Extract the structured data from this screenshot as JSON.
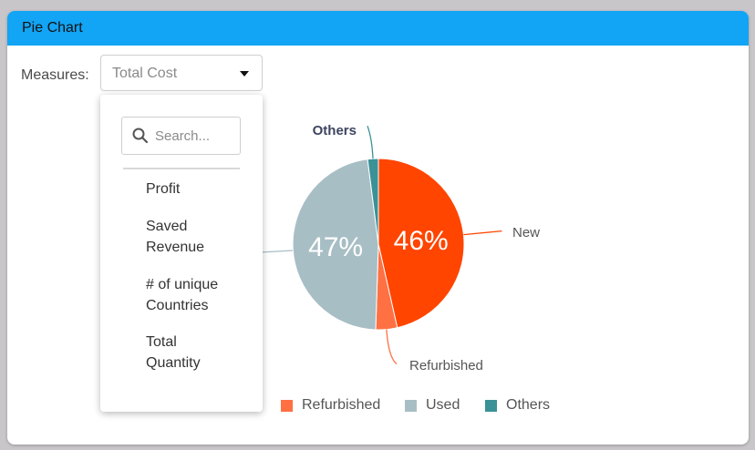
{
  "panel": {
    "title": "Pie Chart"
  },
  "measures": {
    "label": "Measures:",
    "selected": "Total Cost",
    "search_placeholder": "Search...",
    "options": [
      {
        "line1": "Profit",
        "line2": ""
      },
      {
        "line1": "Saved",
        "line2": "Revenue"
      },
      {
        "line1": "# of unique",
        "line2": "Countries"
      },
      {
        "line1": "Total",
        "line2": "Quantity"
      }
    ]
  },
  "colors": {
    "header": "#12a4f5",
    "new": "#ff4500",
    "refurbished": "#ff7043",
    "used": "#a8bec5",
    "others": "#3a9196"
  },
  "chart_data": {
    "type": "pie",
    "slices": [
      {
        "name": "New",
        "value": 46,
        "label": "46%",
        "color": "#ff4500"
      },
      {
        "name": "Refurbished",
        "value": 4,
        "label": "",
        "color": "#ff7043"
      },
      {
        "name": "Used",
        "value": 47,
        "label": "47%",
        "color": "#a8bec5"
      },
      {
        "name": "Others",
        "value": 2,
        "label": "",
        "color": "#3a9196"
      }
    ],
    "callouts": [
      "New",
      "Refurbished",
      "Others"
    ],
    "legend": [
      {
        "name": "Refurbished",
        "color": "#ff7043"
      },
      {
        "name": "Used",
        "color": "#a8bec5"
      },
      {
        "name": "Others",
        "color": "#3a9196"
      }
    ],
    "legend_position": "bottom"
  }
}
